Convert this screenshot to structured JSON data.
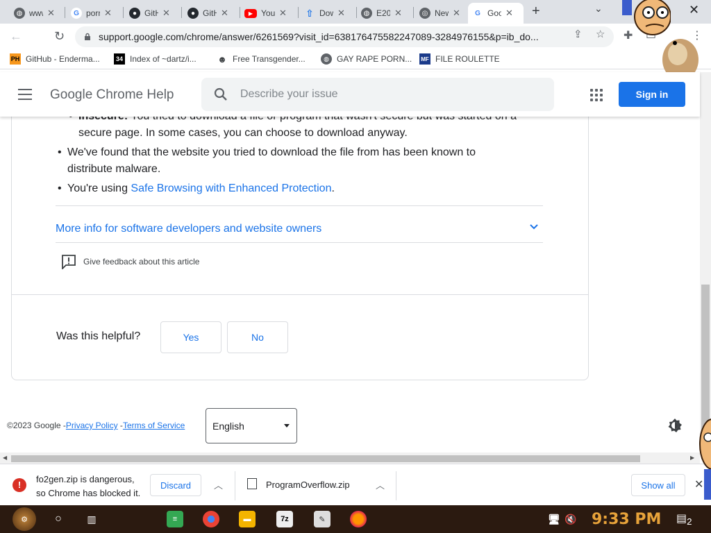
{
  "tabs": [
    {
      "title": "www",
      "icon": "globe-icon",
      "color": "#5f6368"
    },
    {
      "title": "porn",
      "icon": "google-icon",
      "color": "#4285f4"
    },
    {
      "title": "GitHub",
      "icon": "github-icon",
      "color": "#24292f"
    },
    {
      "title": "GitHub",
      "icon": "github-icon",
      "color": "#24292f"
    },
    {
      "title": "YouTube",
      "icon": "youtube-icon",
      "color": "#ff0000"
    },
    {
      "title": "Download",
      "icon": "download-arrow-icon",
      "color": "#1a73e8"
    },
    {
      "title": "E20",
      "icon": "globe-icon",
      "color": "#5f6368"
    },
    {
      "title": "New",
      "icon": "chrome-icon",
      "color": "#5f6368"
    },
    {
      "title": "Google",
      "icon": "google-icon",
      "color": "#4285f4",
      "active": true
    }
  ],
  "toolbar": {
    "url": "support.google.com/chrome/answer/6261569?visit_id=638176475582247089-3284976155&p=ib_do..."
  },
  "bookmarks": [
    {
      "label": "GitHub - Enderma...",
      "icon": "PH"
    },
    {
      "label": "Index of ~dartz/i...",
      "icon": "34"
    },
    {
      "label": "Free Transgender...",
      "icon": "mask"
    },
    {
      "label": "GAY RAPE PORN...",
      "icon": "globe"
    },
    {
      "label": "FILE ROULETTE",
      "icon": "MF"
    }
  ],
  "header": {
    "title": "Google Chrome Help",
    "search_placeholder": "Describe your issue",
    "signin": "Sign in"
  },
  "article": {
    "bullet0_bold": "Insecure:",
    "bullet0_text": " You tried to download a file or program that wasn't secure but was started on a",
    "bullet0_line2": "secure page. In some cases, you can choose to download anyway.",
    "bullet1_line1": "We've found that the website you tried to download the file from has been known to",
    "bullet1_line2": "distribute malware.",
    "bullet2_prefix": "You're using ",
    "bullet2_link": "Safe Browsing with Enhanced Protection",
    "bullet2_suffix": ".",
    "more_info": "More info for software developers and website owners",
    "feedback": "Give feedback about this article",
    "helpful_question": "Was this helpful?",
    "yes": "Yes",
    "no": "No"
  },
  "footer": {
    "copyright": "©2023 Google -",
    "privacy": "Privacy Policy",
    "dash": " -",
    "terms": "Terms of Service",
    "language": "English"
  },
  "downloads": {
    "blocked_line1": "fo2gen.zip is dangerous,",
    "blocked_line2": "so Chrome has blocked it.",
    "discard": "Discard",
    "file2": "ProgramOverflow.zip",
    "show_all": "Show all"
  },
  "taskbar": {
    "time": "9:33 PM",
    "notifications": "2"
  },
  "colors": {
    "accent": "#1a73e8",
    "danger": "#d93025",
    "clock": "#e8a33a"
  }
}
